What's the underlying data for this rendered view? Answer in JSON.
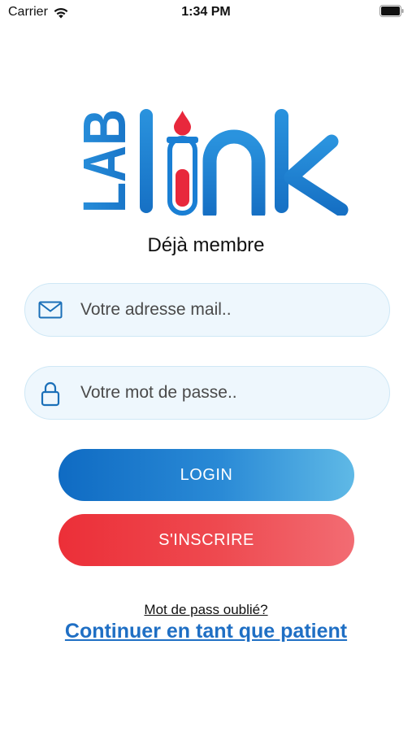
{
  "status_bar": {
    "carrier": "Carrier",
    "time": "1:34 PM"
  },
  "logo": {
    "part1": "LAB",
    "part2": "link"
  },
  "heading": "Déjà membre",
  "email_field": {
    "placeholder": "Votre adresse mail..",
    "value": ""
  },
  "password_field": {
    "placeholder": "Votre mot de passe..",
    "value": ""
  },
  "buttons": {
    "login": "LOGIN",
    "signup": "S'INSCRIRE"
  },
  "links": {
    "forgot": "Mot de pass oublié?",
    "patient": "Continuer en tant que patient"
  },
  "colors": {
    "brand_blue": "#1a7fd4",
    "brand_red": "#e8283c",
    "login_gradient": [
      "#0f6bc3",
      "#5fb9e6"
    ],
    "signup_gradient": [
      "#ec2f38",
      "#f26c73"
    ],
    "link_blue": "#1f6fc4",
    "field_background": "#eef7fd"
  },
  "icons": {
    "wifi": "wifi-icon",
    "battery": "battery-icon",
    "email": "envelope-icon",
    "password": "lock-icon"
  }
}
